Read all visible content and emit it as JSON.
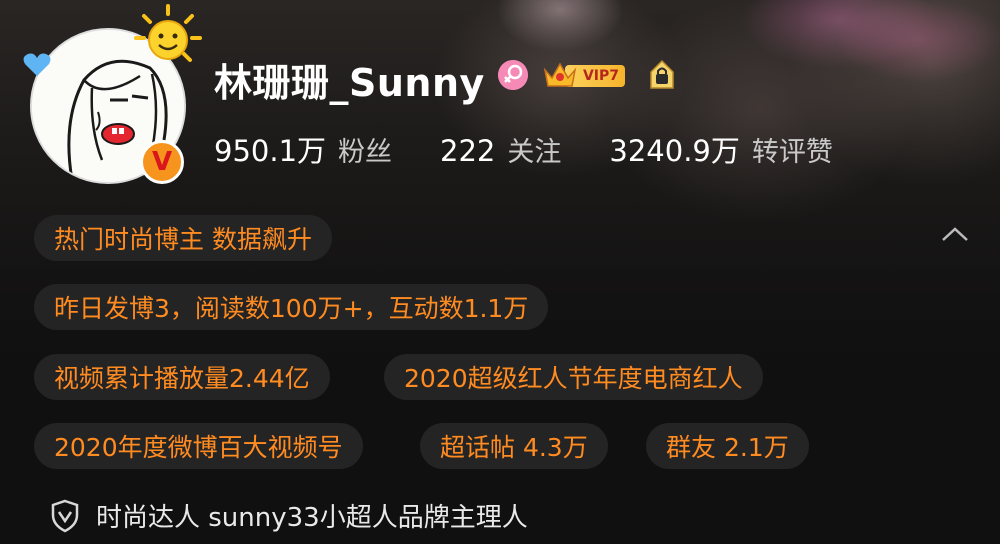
{
  "profile": {
    "name": "林珊珊_Sunny",
    "vip_label": "VIP7"
  },
  "stats": [
    {
      "value": "950.1万",
      "label": "粉丝"
    },
    {
      "value": "222",
      "label": "关注"
    },
    {
      "value": "3240.9万",
      "label": "转评赞"
    }
  ],
  "tags": [
    "热门时尚博主 数据飙升",
    "昨日发博3，阅读数100万+，互动数1.1万",
    "视频累计播放量2.44亿",
    "2020超级红人节年度电商红人",
    "2020年度微博百大视频号",
    "超话帖 4.3万",
    "群友 2.1万"
  ],
  "verification": {
    "text": "时尚达人 sunny33小超人品牌主理人"
  },
  "icons": {
    "verified": "verified-v-badge",
    "gender": "female-gender-icon",
    "vip": "vip-crown-icon",
    "lock": "lock-badge-icon",
    "collapse": "chevron-up-icon",
    "shield": "shield-check-icon",
    "sun": "sun-sticker-icon",
    "heart": "heart-sticker-icon"
  },
  "colors": {
    "accent_orange": "#ff8b21",
    "background": "#101010",
    "tag_bg": "#262626",
    "vip_gold": "#f6b42c",
    "gender_pink": "#f58ab7",
    "verified_orange": "#f7941d"
  }
}
